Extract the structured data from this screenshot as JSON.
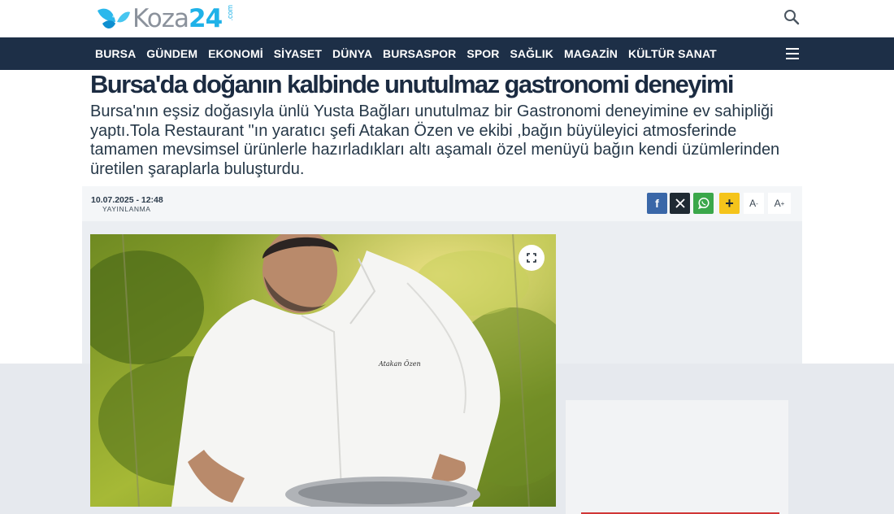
{
  "header": {
    "logo_word": "Koza",
    "logo_number": "24",
    "logo_tld": ".com",
    "search_icon": "search-icon"
  },
  "nav": {
    "items": [
      "BURSA",
      "GÜNDEM",
      "EKONOMİ",
      "SİYASET",
      "DÜNYA",
      "BURSASPOR",
      "SPOR",
      "SAĞLIK",
      "MAGAZİN",
      "KÜLTÜR SANAT"
    ],
    "menu_icon": "hamburger-menu-icon"
  },
  "article": {
    "title": "Bursa'da doğanın kalbinde unutulmaz gastronomi deneyimi",
    "summary": "Bursa'nın eşsiz doğasıyla ünlü Yusta Bağları unutulmaz bir Gastronomi deneyimine ev sahipliği yaptı.Tola Restaurant \"ın yaratıcı şefi Atakan Özen ve ekibi ,bağın büyüleyici atmosferinde tamamen mevsimsel ürünlerle hazırladıkları altı aşamalı özel menüyü bağın kendi üzümlerinden üretilen şaraplarla buluşturdu.",
    "date": "10.07.2025 - 12:48",
    "date_label": "YAYINLANMA",
    "shirt_embroidery": "Atakan Özen"
  },
  "share": {
    "facebook": "f",
    "x": "𝕏",
    "plus": "+",
    "font_decrease": "A",
    "font_increase": "A"
  },
  "colors": {
    "nav_bg": "#1d2f47",
    "brand_blue": "#1fb2e8",
    "facebook": "#3a67a8",
    "whatsapp": "#3aa74a",
    "plus": "#f5c41b"
  }
}
